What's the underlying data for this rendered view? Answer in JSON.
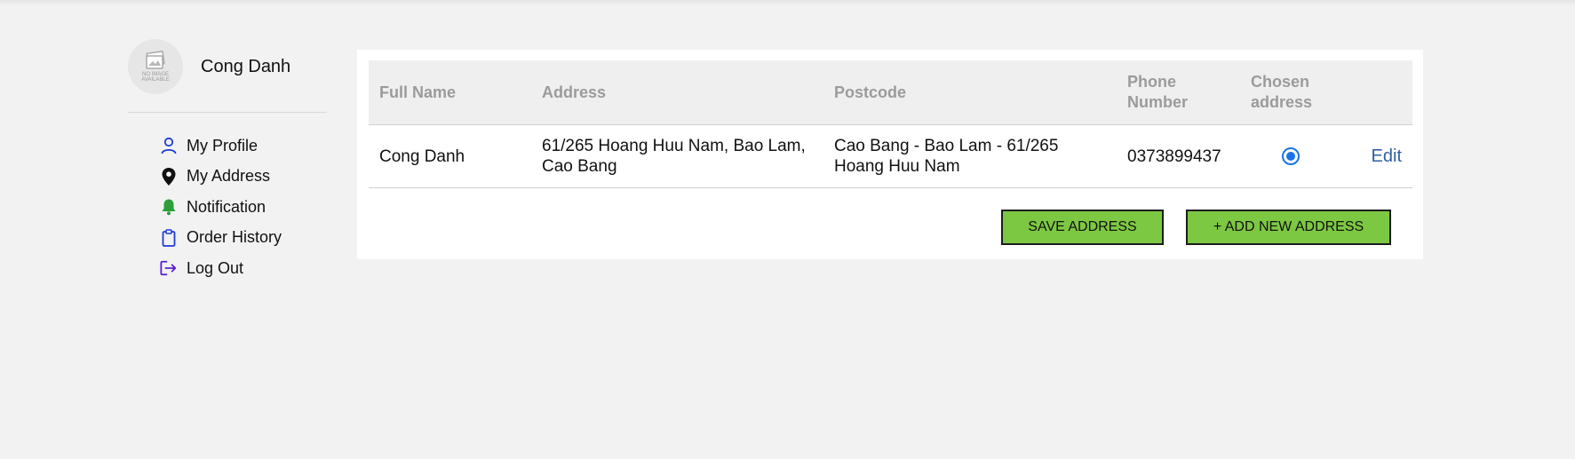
{
  "user": {
    "name": "Cong Danh",
    "avatar_placeholder_line1": "NO IMAGE",
    "avatar_placeholder_line2": "AVAILABLE"
  },
  "sidebar": {
    "items": [
      {
        "label": "My Profile",
        "icon": "user-icon",
        "icon_color": "#1f3bd8"
      },
      {
        "label": "My Address",
        "icon": "location-pin-icon",
        "icon_color": "#111111"
      },
      {
        "label": "Notification",
        "icon": "bell-icon",
        "icon_color": "#2e9e3a"
      },
      {
        "label": "Order History",
        "icon": "clipboard-icon",
        "icon_color": "#1f3bd8"
      },
      {
        "label": "Log Out",
        "icon": "logout-icon",
        "icon_color": "#5a1fd8"
      }
    ]
  },
  "table": {
    "headers": {
      "full_name": "Full Name",
      "address": "Address",
      "postcode": "Postcode",
      "phone": "Phone Number",
      "chosen": "Chosen address"
    },
    "rows": [
      {
        "full_name": "Cong Danh",
        "address": "61/265 Hoang Huu Nam, Bao Lam, Cao Bang",
        "postcode": "Cao Bang - Bao Lam - 61/265 Hoang Huu Nam",
        "phone": "0373899437",
        "chosen": true,
        "action": "Edit"
      }
    ]
  },
  "buttons": {
    "save": "SAVE ADDRESS",
    "add": "+ ADD NEW ADDRESS"
  },
  "colors": {
    "accent_green": "#7dc842",
    "radio_blue": "#1a73e8",
    "link_blue": "#2f5fa8"
  }
}
